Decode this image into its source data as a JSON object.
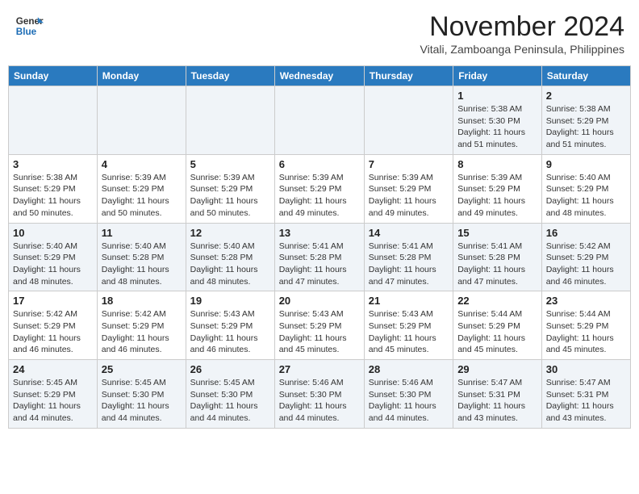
{
  "header": {
    "logo_general": "General",
    "logo_blue": "Blue",
    "month_title": "November 2024",
    "location": "Vitali, Zamboanga Peninsula, Philippines"
  },
  "weekdays": [
    "Sunday",
    "Monday",
    "Tuesday",
    "Wednesday",
    "Thursday",
    "Friday",
    "Saturday"
  ],
  "weeks": [
    [
      {
        "day": "",
        "info": ""
      },
      {
        "day": "",
        "info": ""
      },
      {
        "day": "",
        "info": ""
      },
      {
        "day": "",
        "info": ""
      },
      {
        "day": "",
        "info": ""
      },
      {
        "day": "1",
        "info": "Sunrise: 5:38 AM\nSunset: 5:30 PM\nDaylight: 11 hours and 51 minutes."
      },
      {
        "day": "2",
        "info": "Sunrise: 5:38 AM\nSunset: 5:29 PM\nDaylight: 11 hours and 51 minutes."
      }
    ],
    [
      {
        "day": "3",
        "info": "Sunrise: 5:38 AM\nSunset: 5:29 PM\nDaylight: 11 hours and 50 minutes."
      },
      {
        "day": "4",
        "info": "Sunrise: 5:39 AM\nSunset: 5:29 PM\nDaylight: 11 hours and 50 minutes."
      },
      {
        "day": "5",
        "info": "Sunrise: 5:39 AM\nSunset: 5:29 PM\nDaylight: 11 hours and 50 minutes."
      },
      {
        "day": "6",
        "info": "Sunrise: 5:39 AM\nSunset: 5:29 PM\nDaylight: 11 hours and 49 minutes."
      },
      {
        "day": "7",
        "info": "Sunrise: 5:39 AM\nSunset: 5:29 PM\nDaylight: 11 hours and 49 minutes."
      },
      {
        "day": "8",
        "info": "Sunrise: 5:39 AM\nSunset: 5:29 PM\nDaylight: 11 hours and 49 minutes."
      },
      {
        "day": "9",
        "info": "Sunrise: 5:40 AM\nSunset: 5:29 PM\nDaylight: 11 hours and 48 minutes."
      }
    ],
    [
      {
        "day": "10",
        "info": "Sunrise: 5:40 AM\nSunset: 5:29 PM\nDaylight: 11 hours and 48 minutes."
      },
      {
        "day": "11",
        "info": "Sunrise: 5:40 AM\nSunset: 5:28 PM\nDaylight: 11 hours and 48 minutes."
      },
      {
        "day": "12",
        "info": "Sunrise: 5:40 AM\nSunset: 5:28 PM\nDaylight: 11 hours and 48 minutes."
      },
      {
        "day": "13",
        "info": "Sunrise: 5:41 AM\nSunset: 5:28 PM\nDaylight: 11 hours and 47 minutes."
      },
      {
        "day": "14",
        "info": "Sunrise: 5:41 AM\nSunset: 5:28 PM\nDaylight: 11 hours and 47 minutes."
      },
      {
        "day": "15",
        "info": "Sunrise: 5:41 AM\nSunset: 5:28 PM\nDaylight: 11 hours and 47 minutes."
      },
      {
        "day": "16",
        "info": "Sunrise: 5:42 AM\nSunset: 5:29 PM\nDaylight: 11 hours and 46 minutes."
      }
    ],
    [
      {
        "day": "17",
        "info": "Sunrise: 5:42 AM\nSunset: 5:29 PM\nDaylight: 11 hours and 46 minutes."
      },
      {
        "day": "18",
        "info": "Sunrise: 5:42 AM\nSunset: 5:29 PM\nDaylight: 11 hours and 46 minutes."
      },
      {
        "day": "19",
        "info": "Sunrise: 5:43 AM\nSunset: 5:29 PM\nDaylight: 11 hours and 46 minutes."
      },
      {
        "day": "20",
        "info": "Sunrise: 5:43 AM\nSunset: 5:29 PM\nDaylight: 11 hours and 45 minutes."
      },
      {
        "day": "21",
        "info": "Sunrise: 5:43 AM\nSunset: 5:29 PM\nDaylight: 11 hours and 45 minutes."
      },
      {
        "day": "22",
        "info": "Sunrise: 5:44 AM\nSunset: 5:29 PM\nDaylight: 11 hours and 45 minutes."
      },
      {
        "day": "23",
        "info": "Sunrise: 5:44 AM\nSunset: 5:29 PM\nDaylight: 11 hours and 45 minutes."
      }
    ],
    [
      {
        "day": "24",
        "info": "Sunrise: 5:45 AM\nSunset: 5:29 PM\nDaylight: 11 hours and 44 minutes."
      },
      {
        "day": "25",
        "info": "Sunrise: 5:45 AM\nSunset: 5:30 PM\nDaylight: 11 hours and 44 minutes."
      },
      {
        "day": "26",
        "info": "Sunrise: 5:45 AM\nSunset: 5:30 PM\nDaylight: 11 hours and 44 minutes."
      },
      {
        "day": "27",
        "info": "Sunrise: 5:46 AM\nSunset: 5:30 PM\nDaylight: 11 hours and 44 minutes."
      },
      {
        "day": "28",
        "info": "Sunrise: 5:46 AM\nSunset: 5:30 PM\nDaylight: 11 hours and 44 minutes."
      },
      {
        "day": "29",
        "info": "Sunrise: 5:47 AM\nSunset: 5:31 PM\nDaylight: 11 hours and 43 minutes."
      },
      {
        "day": "30",
        "info": "Sunrise: 5:47 AM\nSunset: 5:31 PM\nDaylight: 11 hours and 43 minutes."
      }
    ]
  ]
}
